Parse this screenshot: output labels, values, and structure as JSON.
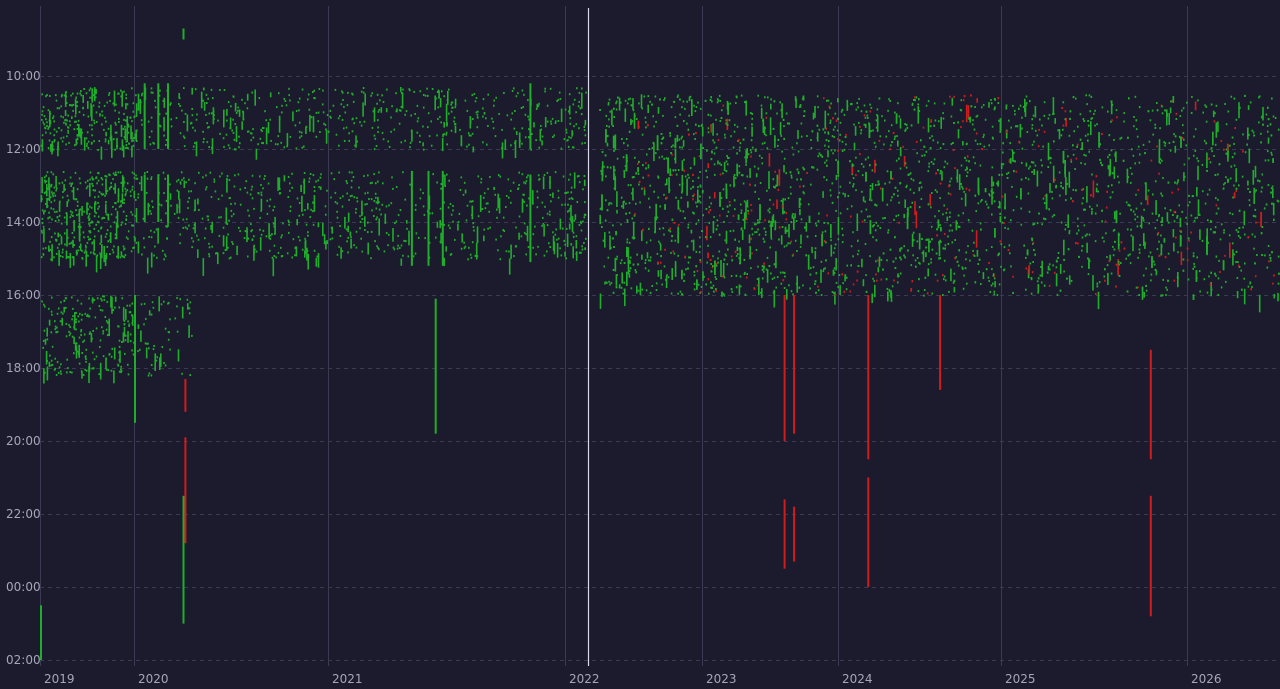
{
  "chart_data": {
    "type": "scatter",
    "title": "",
    "xlabel": "",
    "ylabel": "",
    "x_tick_labels": [
      "2019",
      "2020",
      "2021",
      "2022",
      "2023",
      "2024",
      "2025",
      "2026"
    ],
    "x_tick_years": [
      2019,
      2020,
      2021,
      2022,
      2023,
      2024,
      2025,
      2026
    ],
    "y_tick_labels": [
      "10:00",
      "12:00",
      "14:00",
      "16:00",
      "18:00",
      "20:00",
      "22:00",
      "00:00",
      "02:00"
    ],
    "y_tick_hours": [
      10,
      12,
      14,
      16,
      18,
      20,
      22,
      24,
      26
    ],
    "xlim": [
      2018.95,
      2026.49
    ],
    "ylim_hours": [
      8.2,
      26.2
    ],
    "y_direction": "time increases downward; 00:00 and 02:00 are after midnight",
    "cursor_x": 2022.17,
    "grid": true,
    "legend": "none",
    "colors": {
      "background": "#1b1b2d",
      "positive": "#1fae2a",
      "negative": "#d01c1c",
      "grid": "#3a3a52",
      "cursor": "#d8d8e6",
      "tick_text": "#a6a6b8"
    },
    "series": [
      {
        "color": "positive",
        "description_dense_bands": [
          {
            "x": [
              2019.0,
              2022.15
            ],
            "hours": [
              10.3,
              12.0
            ]
          },
          {
            "x": [
              2019.0,
              2022.15
            ],
            "hours": [
              12.6,
              15.0
            ]
          },
          {
            "x": [
              2019.0,
              2020.3
            ],
            "hours": [
              16.0,
              18.2
            ]
          },
          {
            "x": [
              2022.25,
              2026.49
            ],
            "hours": [
              10.5,
              16.0
            ]
          }
        ],
        "long_segments": [
          {
            "x": 2019.0,
            "hours": [
              24.5,
              26.0
            ]
          },
          {
            "x": 2020.05,
            "hours": [
              10.2,
              12.0
            ]
          },
          {
            "x": 2020.12,
            "hours": [
              10.2,
              12.0
            ]
          },
          {
            "x": 2020.17,
            "hours": [
              10.2,
              12.0
            ]
          },
          {
            "x": 2020.05,
            "hours": [
              12.7,
              14.0
            ]
          },
          {
            "x": 2020.12,
            "hours": [
              12.7,
              14.0
            ]
          },
          {
            "x": 2020.17,
            "hours": [
              12.7,
              14.0
            ]
          },
          {
            "x": 2020.25,
            "hours": [
              8.7,
              9.0
            ]
          },
          {
            "x": 2020.25,
            "hours": [
              21.5,
              25.0
            ]
          },
          {
            "x": 2020.0,
            "hours": [
              16.0,
              19.5
            ]
          },
          {
            "x": 2021.35,
            "hours": [
              12.6,
              15.2
            ]
          },
          {
            "x": 2021.42,
            "hours": [
              12.6,
              15.2
            ]
          },
          {
            "x": 2021.48,
            "hours": [
              12.6,
              15.2
            ]
          },
          {
            "x": 2021.45,
            "hours": [
              16.1,
              19.8
            ]
          },
          {
            "x": 2021.85,
            "hours": [
              10.2,
              12.0
            ]
          },
          {
            "x": 2021.85,
            "hours": [
              12.7,
              15.1
            ]
          }
        ]
      },
      {
        "color": "negative",
        "long_segments": [
          {
            "x": 2020.26,
            "hours": [
              18.3,
              19.2
            ]
          },
          {
            "x": 2020.26,
            "hours": [
              19.9,
              22.8
            ]
          },
          {
            "x": 2023.6,
            "hours": [
              16.0,
              20.0
            ]
          },
          {
            "x": 2023.6,
            "hours": [
              21.6,
              23.5
            ]
          },
          {
            "x": 2023.67,
            "hours": [
              16.0,
              19.8
            ]
          },
          {
            "x": 2023.67,
            "hours": [
              21.8,
              23.3
            ]
          },
          {
            "x": 2024.18,
            "hours": [
              16.0,
              20.5
            ]
          },
          {
            "x": 2024.18,
            "hours": [
              21.0,
              24.0
            ]
          },
          {
            "x": 2024.62,
            "hours": [
              16.0,
              18.6
            ]
          },
          {
            "x": 2025.8,
            "hours": [
              17.5,
              20.5
            ]
          },
          {
            "x": 2025.8,
            "hours": [
              21.5,
              24.8
            ]
          }
        ]
      }
    ]
  }
}
